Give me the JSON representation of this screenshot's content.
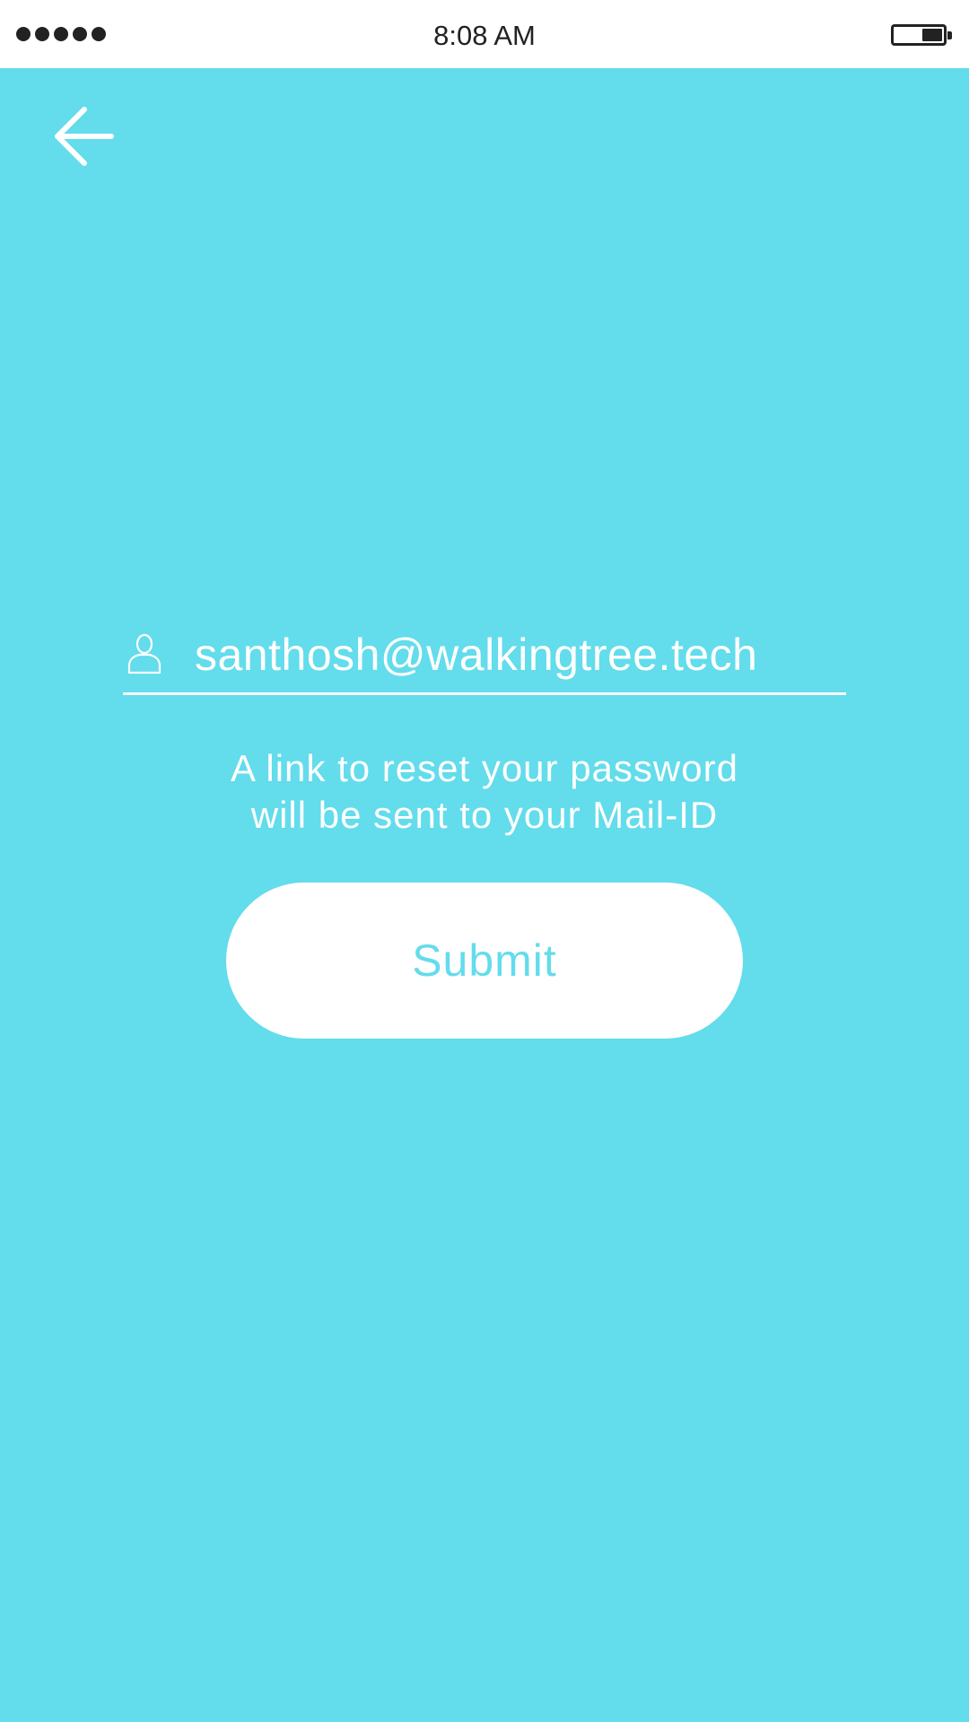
{
  "status_bar": {
    "time": "8:08 AM",
    "signal_icon": "signal-dots-icon",
    "battery_icon": "battery-icon"
  },
  "header": {
    "back_icon": "arrow-left-icon"
  },
  "form": {
    "email_icon": "user-icon",
    "email_value": "santhosh@walkingtree.tech",
    "helper_text": "A link to reset your password\nwill be sent to your Mail-ID",
    "submit_label": "Submit"
  },
  "colors": {
    "background": "#63dcec",
    "text": "#ffffff",
    "status_text": "#222222"
  }
}
